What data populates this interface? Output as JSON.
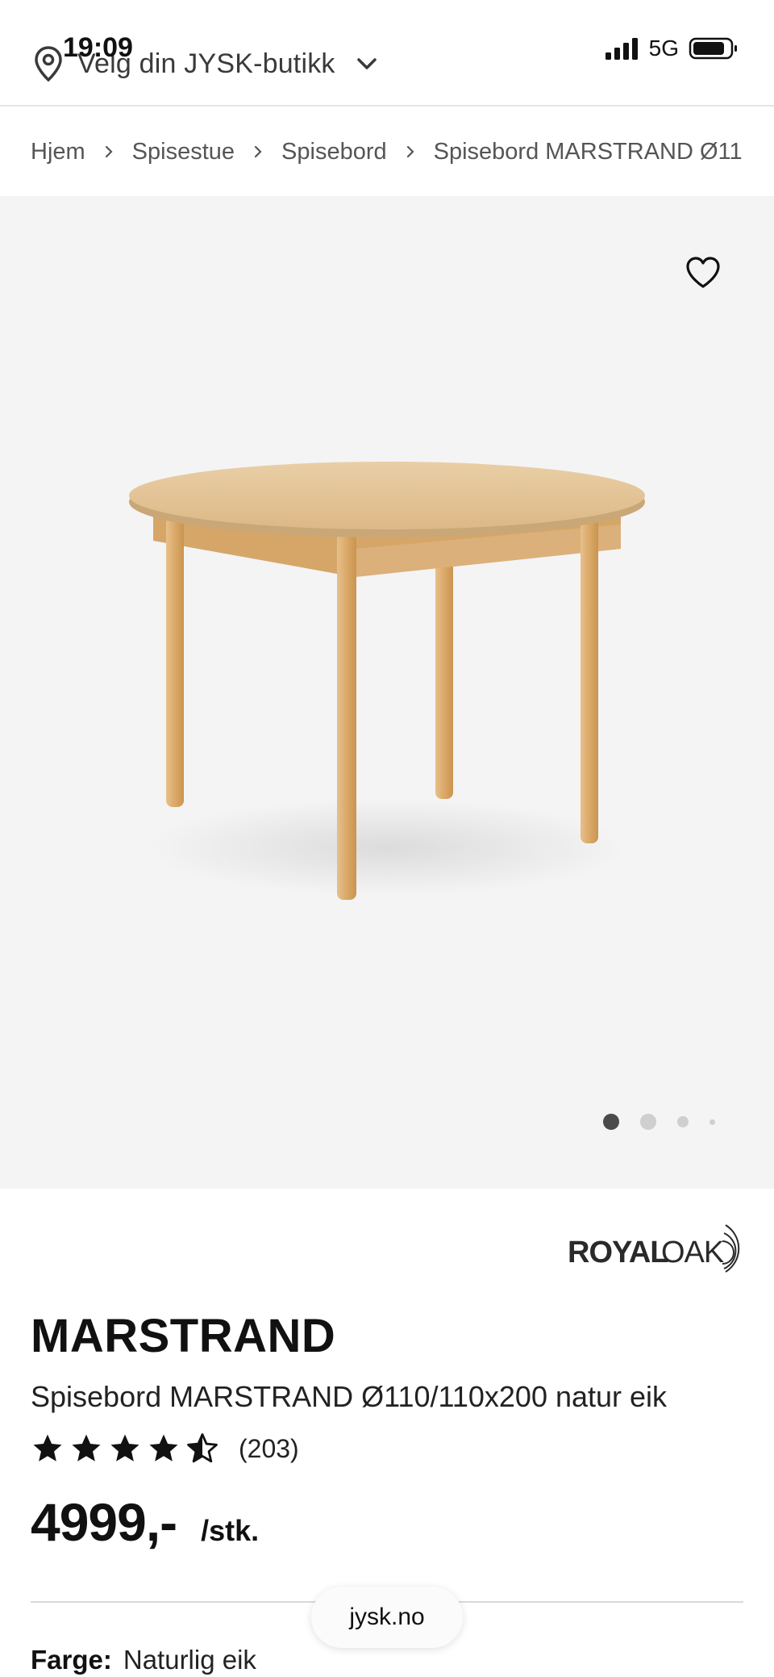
{
  "status_bar": {
    "time": "19:09",
    "network": "5G"
  },
  "header": {
    "store_select_label": "Velg din JYSK-butikk",
    "icons": {
      "location": "location-pin-icon",
      "dropdown": "chevron-down-icon"
    }
  },
  "breadcrumb": {
    "items": [
      "Hjem",
      "Spisestue",
      "Spisebord",
      "Spisebord MARSTRAND Ø11"
    ]
  },
  "gallery": {
    "favorite_icon": "heart-icon",
    "slide_count": 4,
    "active_slide": 1
  },
  "product": {
    "brand_logo_text": "ROYALOAK",
    "name": "MARSTRAND",
    "subtitle": "Spisebord MARSTRAND Ø110/110x200 natur eik",
    "rating": 4.5,
    "rating_max": 5,
    "review_count": "(203)",
    "price": "4999,-",
    "unit": "/stk.",
    "color_label": "Farge:",
    "color_value": "Naturlig eik"
  },
  "browser": {
    "url": "jysk.no"
  },
  "colors": {
    "gallery_bg": "#f4f4f5",
    "wood_light": "#e8c79a",
    "wood_mid": "#d9ac70",
    "text": "#111111"
  }
}
